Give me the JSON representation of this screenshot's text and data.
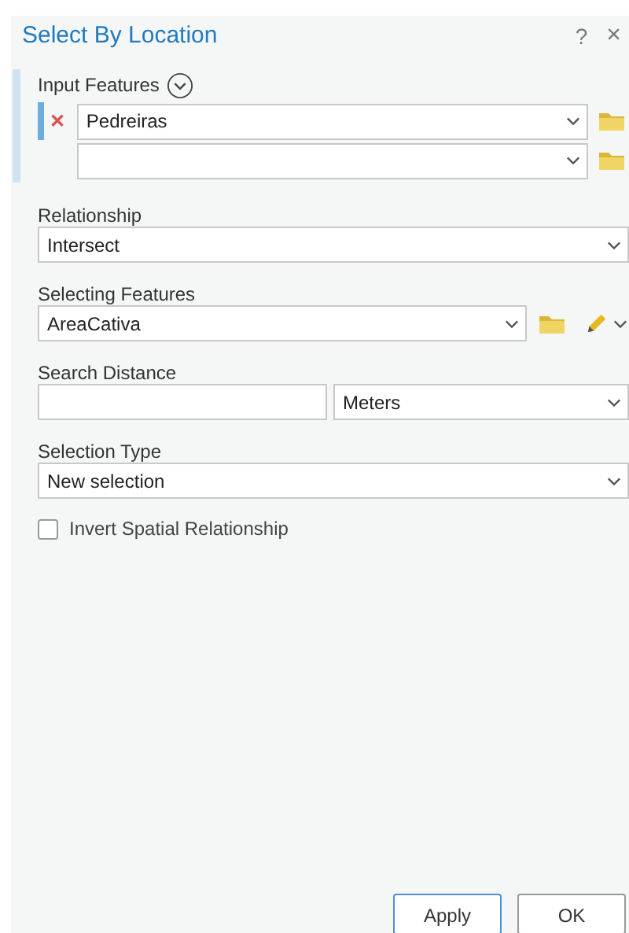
{
  "window": {
    "title": "Select By Location",
    "help": "?",
    "close": "×"
  },
  "input_features": {
    "label": "Input Features",
    "rows": [
      {
        "value": "Pedreiras",
        "removable": true,
        "remove_icon": "✕"
      },
      {
        "removable": false
      }
    ]
  },
  "relationship": {
    "label": "Relationship",
    "value": "Intersect"
  },
  "selecting_features": {
    "label": "Selecting Features",
    "value": "AreaCativa"
  },
  "search_distance": {
    "label": "Search Distance",
    "unit": "Meters"
  },
  "selection_type": {
    "label": "Selection Type",
    "value": "New selection"
  },
  "invert": {
    "label": "Invert Spatial Relationship",
    "checked": false
  },
  "buttons": [
    {
      "label": "Apply",
      "kind": "focused"
    },
    {
      "label": "OK",
      "kind": "plain"
    }
  ]
}
